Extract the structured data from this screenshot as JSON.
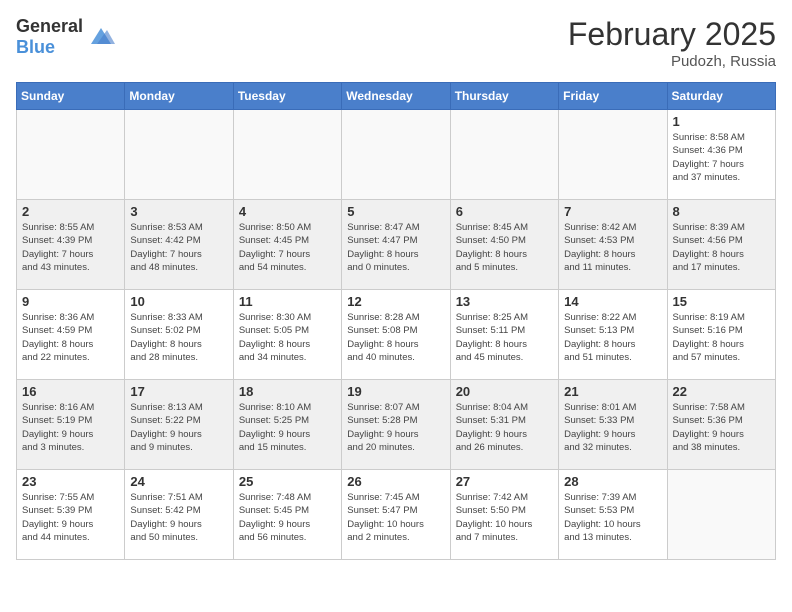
{
  "logo": {
    "general": "General",
    "blue": "Blue"
  },
  "title": {
    "month": "February 2025",
    "location": "Pudozh, Russia"
  },
  "weekdays": [
    "Sunday",
    "Monday",
    "Tuesday",
    "Wednesday",
    "Thursday",
    "Friday",
    "Saturday"
  ],
  "weeks": [
    [
      {
        "day": "",
        "info": ""
      },
      {
        "day": "",
        "info": ""
      },
      {
        "day": "",
        "info": ""
      },
      {
        "day": "",
        "info": ""
      },
      {
        "day": "",
        "info": ""
      },
      {
        "day": "",
        "info": ""
      },
      {
        "day": "1",
        "info": "Sunrise: 8:58 AM\nSunset: 4:36 PM\nDaylight: 7 hours\nand 37 minutes."
      }
    ],
    [
      {
        "day": "2",
        "info": "Sunrise: 8:55 AM\nSunset: 4:39 PM\nDaylight: 7 hours\nand 43 minutes."
      },
      {
        "day": "3",
        "info": "Sunrise: 8:53 AM\nSunset: 4:42 PM\nDaylight: 7 hours\nand 48 minutes."
      },
      {
        "day": "4",
        "info": "Sunrise: 8:50 AM\nSunset: 4:45 PM\nDaylight: 7 hours\nand 54 minutes."
      },
      {
        "day": "5",
        "info": "Sunrise: 8:47 AM\nSunset: 4:47 PM\nDaylight: 8 hours\nand 0 minutes."
      },
      {
        "day": "6",
        "info": "Sunrise: 8:45 AM\nSunset: 4:50 PM\nDaylight: 8 hours\nand 5 minutes."
      },
      {
        "day": "7",
        "info": "Sunrise: 8:42 AM\nSunset: 4:53 PM\nDaylight: 8 hours\nand 11 minutes."
      },
      {
        "day": "8",
        "info": "Sunrise: 8:39 AM\nSunset: 4:56 PM\nDaylight: 8 hours\nand 17 minutes."
      }
    ],
    [
      {
        "day": "9",
        "info": "Sunrise: 8:36 AM\nSunset: 4:59 PM\nDaylight: 8 hours\nand 22 minutes."
      },
      {
        "day": "10",
        "info": "Sunrise: 8:33 AM\nSunset: 5:02 PM\nDaylight: 8 hours\nand 28 minutes."
      },
      {
        "day": "11",
        "info": "Sunrise: 8:30 AM\nSunset: 5:05 PM\nDaylight: 8 hours\nand 34 minutes."
      },
      {
        "day": "12",
        "info": "Sunrise: 8:28 AM\nSunset: 5:08 PM\nDaylight: 8 hours\nand 40 minutes."
      },
      {
        "day": "13",
        "info": "Sunrise: 8:25 AM\nSunset: 5:11 PM\nDaylight: 8 hours\nand 45 minutes."
      },
      {
        "day": "14",
        "info": "Sunrise: 8:22 AM\nSunset: 5:13 PM\nDaylight: 8 hours\nand 51 minutes."
      },
      {
        "day": "15",
        "info": "Sunrise: 8:19 AM\nSunset: 5:16 PM\nDaylight: 8 hours\nand 57 minutes."
      }
    ],
    [
      {
        "day": "16",
        "info": "Sunrise: 8:16 AM\nSunset: 5:19 PM\nDaylight: 9 hours\nand 3 minutes."
      },
      {
        "day": "17",
        "info": "Sunrise: 8:13 AM\nSunset: 5:22 PM\nDaylight: 9 hours\nand 9 minutes."
      },
      {
        "day": "18",
        "info": "Sunrise: 8:10 AM\nSunset: 5:25 PM\nDaylight: 9 hours\nand 15 minutes."
      },
      {
        "day": "19",
        "info": "Sunrise: 8:07 AM\nSunset: 5:28 PM\nDaylight: 9 hours\nand 20 minutes."
      },
      {
        "day": "20",
        "info": "Sunrise: 8:04 AM\nSunset: 5:31 PM\nDaylight: 9 hours\nand 26 minutes."
      },
      {
        "day": "21",
        "info": "Sunrise: 8:01 AM\nSunset: 5:33 PM\nDaylight: 9 hours\nand 32 minutes."
      },
      {
        "day": "22",
        "info": "Sunrise: 7:58 AM\nSunset: 5:36 PM\nDaylight: 9 hours\nand 38 minutes."
      }
    ],
    [
      {
        "day": "23",
        "info": "Sunrise: 7:55 AM\nSunset: 5:39 PM\nDaylight: 9 hours\nand 44 minutes."
      },
      {
        "day": "24",
        "info": "Sunrise: 7:51 AM\nSunset: 5:42 PM\nDaylight: 9 hours\nand 50 minutes."
      },
      {
        "day": "25",
        "info": "Sunrise: 7:48 AM\nSunset: 5:45 PM\nDaylight: 9 hours\nand 56 minutes."
      },
      {
        "day": "26",
        "info": "Sunrise: 7:45 AM\nSunset: 5:47 PM\nDaylight: 10 hours\nand 2 minutes."
      },
      {
        "day": "27",
        "info": "Sunrise: 7:42 AM\nSunset: 5:50 PM\nDaylight: 10 hours\nand 7 minutes."
      },
      {
        "day": "28",
        "info": "Sunrise: 7:39 AM\nSunset: 5:53 PM\nDaylight: 10 hours\nand 13 minutes."
      },
      {
        "day": "",
        "info": ""
      }
    ]
  ]
}
